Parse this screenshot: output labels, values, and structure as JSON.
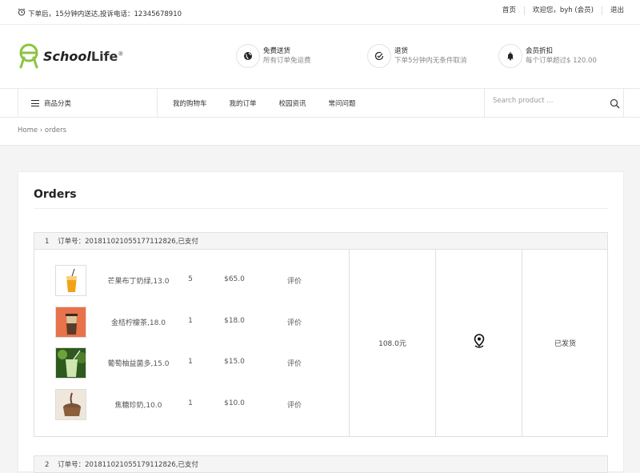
{
  "topbar": {
    "notice": "下单后，15分钟内送达,投诉电话：12345678910",
    "links": [
      "首页",
      "欢迎您，byh (会员)",
      "退出"
    ]
  },
  "logo": {
    "part1": "School",
    "part2": "Life",
    "mark": "®"
  },
  "features": [
    {
      "title": "免费送货",
      "desc": "所有订单免运费",
      "icon": "globe-icon"
    },
    {
      "title": "退货",
      "desc": "下单5分钟内无条件取消",
      "icon": "check-circle-icon"
    },
    {
      "title": "会员折扣",
      "desc": "每个订单超过$ 120.00",
      "icon": "bell-icon"
    }
  ],
  "nav": {
    "category_label": "商品分类",
    "links": [
      "我的购物车",
      "我的订单",
      "校园资讯",
      "常问问题"
    ],
    "search_placeholder": "Search product ..."
  },
  "breadcrumb": {
    "home": "Home",
    "separator": "›",
    "current": "orders"
  },
  "page": {
    "title": "Orders"
  },
  "orders": [
    {
      "index": "1",
      "header": "订单号：20181102105517711282​6,已支付",
      "items": [
        {
          "name": "芒果布丁奶绿,13.0",
          "qty": "5",
          "price": "$65.0",
          "review": "评价"
        },
        {
          "name": "金桔柠檬茶,18.0",
          "qty": "1",
          "price": "$18.0",
          "review": "评价"
        },
        {
          "name": "葡萄柚益菌多,15.0",
          "qty": "1",
          "price": "$15.0",
          "review": "评价"
        },
        {
          "name": "焦糖珍奶,10.0",
          "qty": "1",
          "price": "$10.0",
          "review": "评价"
        }
      ],
      "total": "108.0元",
      "status": "已发货"
    },
    {
      "index": "2",
      "header": "订单号：20181102105517911282​6,已支付"
    }
  ]
}
